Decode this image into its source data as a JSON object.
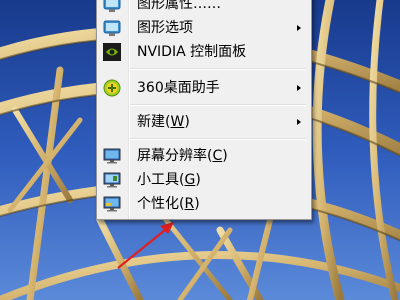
{
  "context_menu": {
    "items": [
      {
        "label": "图形属性……",
        "has_submenu": false,
        "icon": "intel-graphics-icon"
      },
      {
        "label": "图形选项",
        "has_submenu": true,
        "icon": "intel-graphics-icon"
      },
      {
        "label": "NVIDIA 控制面板",
        "has_submenu": false,
        "icon": "nvidia-icon"
      },
      {
        "label": "360桌面助手",
        "has_submenu": true,
        "icon": "360-desktop-icon"
      },
      {
        "label": "新建",
        "accel": "W",
        "has_submenu": true
      },
      {
        "label": "屏幕分辨率",
        "accel": "C",
        "has_submenu": false,
        "icon": "screen-resolution-icon"
      },
      {
        "label": "小工具",
        "accel": "G",
        "has_submenu": false,
        "icon": "gadgets-icon"
      },
      {
        "label": "个性化",
        "accel": "R",
        "has_submenu": false,
        "icon": "personalize-icon"
      }
    ]
  },
  "colors": {
    "sky": "#2e58b6",
    "menu_bg": "#f0f0f0",
    "annotation_arrow": "#e02020"
  }
}
